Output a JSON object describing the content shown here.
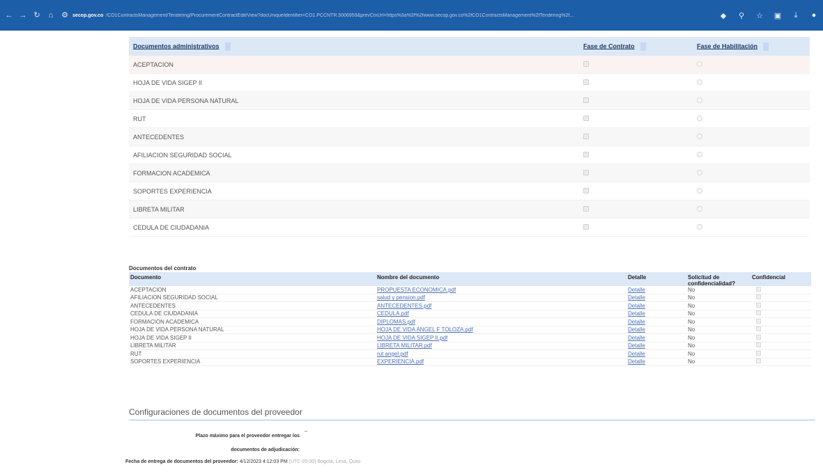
{
  "browser": {
    "url_host": "secop.gov.co",
    "url_path": "/CO1ContractsManagement/Tendering/ProcurementContractEdit/View?docUniqueIdentifier=CO1.PCCNTR.5006959&prevCtxUrl=https%3a%2f%2fwww.secop.gov.co%2fCO1ContractsManagement%2fTendering%2f..."
  },
  "admin_docs": {
    "headers": {
      "documento": "Documentos administrativos",
      "contrato": "Fase de Contrato",
      "habilitacion": "Fase de Habilitación"
    },
    "rows": [
      "ACEPTACION",
      "HOJA DE VIDA SIGEP II",
      "HOJA DE VIDA PERSONA NATURAL",
      "RUT",
      "ANTECEDENTES",
      "AFILIACION SEGURIDAD SOCIAL",
      "FORMACION ACADEMICA",
      "SOPORTES EXPERIENCIA",
      "LIBRETA MILITAR",
      "CEDULA DE CIUDADANIA"
    ]
  },
  "contract_docs": {
    "title": "Documentos del contrato",
    "headers": {
      "documento": "Documento",
      "nombre": "Nombre del documento",
      "detalle": "Detalle",
      "solicitud": "Solicitud de confidencialidad?",
      "confidencial": "Confidencial"
    },
    "rows": [
      {
        "documento": "ACEPTACION",
        "nombre": "PROPUESTA ECONOMICA.pdf",
        "detalle": "Detalle",
        "solicitud": "No"
      },
      {
        "documento": "AFILIACION SEGURIDAD SOCIAL",
        "nombre": "salud y pension.pdf",
        "detalle": "Detalle",
        "solicitud": "No"
      },
      {
        "documento": "ANTECEDENTES",
        "nombre": "ANTECEDENTES.pdf",
        "detalle": "Detalle",
        "solicitud": "No"
      },
      {
        "documento": "CEDULA DE CIUDADANIA",
        "nombre": "CEDULA.pdf",
        "detalle": "Detalle",
        "solicitud": "No"
      },
      {
        "documento": "FORMACION ACADEMICA",
        "nombre": "DIPLOMAS.pdf",
        "detalle": "Detalle",
        "solicitud": "No"
      },
      {
        "documento": "HOJA DE VIDA PERSONA NATURAL",
        "nombre": "HOJA DE VIDA ANGEL F TOLOZA.pdf",
        "detalle": "Detalle",
        "solicitud": "No"
      },
      {
        "documento": "HOJA DE VIDA SIGEP II",
        "nombre": "HOJA DE VIDA SIGEP II.pdf",
        "detalle": "Detalle",
        "solicitud": "No"
      },
      {
        "documento": "LIBRETA MILITAR",
        "nombre": "LIBRETA MILITAR.pdf",
        "detalle": "Detalle",
        "solicitud": "No"
      },
      {
        "documento": "RUT",
        "nombre": "rut angel.pdf",
        "detalle": "Detalle",
        "solicitud": "No"
      },
      {
        "documento": "SOPORTES EXPERIENCIA",
        "nombre": "EXPERIENCIA.pdf",
        "detalle": "Detalle",
        "solicitud": "No"
      }
    ]
  },
  "config": {
    "title": "Configuraciones de documentos del proveedor",
    "plazo_label_1": "Plazo máximo para el proveedor entregar los",
    "plazo_label_2": "documentos de adjudicación:",
    "plazo_value": "-",
    "fecha_label": "Fecha de entrega de documentos del proveedor:",
    "fecha_value": "4/12/2023 4:12:03 PM",
    "fecha_tz": "(UTC-05:00) Bogotá, Lima, Quito"
  }
}
